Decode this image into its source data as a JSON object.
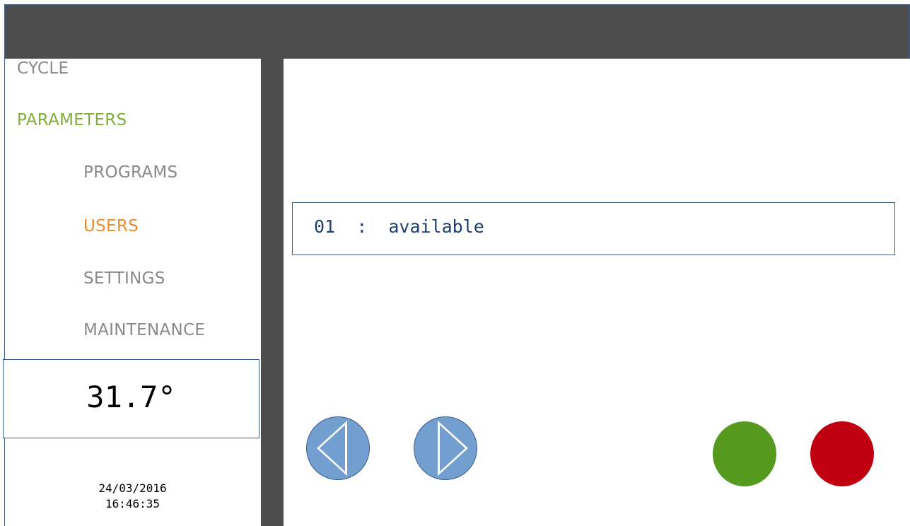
{
  "sidebar": {
    "items": [
      {
        "label": "CYCLE"
      },
      {
        "label": "PARAMETERS"
      },
      {
        "label": "PROGRAMS"
      },
      {
        "label": "USERS"
      },
      {
        "label": "SETTINGS"
      },
      {
        "label": "MAINTENANCE"
      }
    ],
    "temperature": "31.7°",
    "date": "24/03/2016",
    "time": "16:46:35"
  },
  "main": {
    "user_status": "01  :  available"
  },
  "controls": {
    "prev_icon": "triangle-left-icon",
    "next_icon": "triangle-right-icon",
    "confirm_color": "#559a1e",
    "cancel_color": "#c00010"
  },
  "colors": {
    "header_bar": "#4d4d4d",
    "active_section": "#7fae3a",
    "active_item": "#f08a2a",
    "inactive_item": "#8a8a8a",
    "nav_button": "#729fcf"
  }
}
